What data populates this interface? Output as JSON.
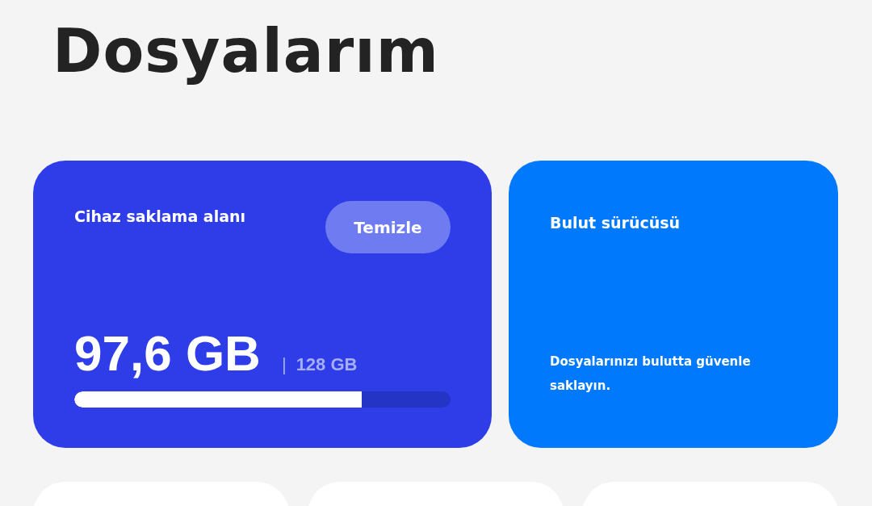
{
  "title": "Dosyalarım",
  "storage_card": {
    "title": "Cihaz saklama alanı",
    "button": "Temizle",
    "used": "97,6 GB",
    "separator": "|",
    "total": "128 GB",
    "level": 0.763
  },
  "cloud_card": {
    "title": "Bulut sürücüsü",
    "description": "Dosyalarınızı bulutta güvenle saklayın."
  }
}
